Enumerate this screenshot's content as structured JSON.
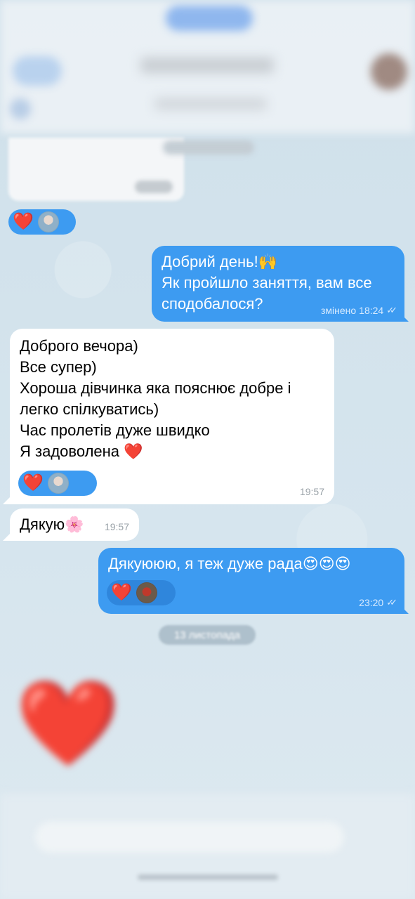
{
  "chat": {
    "messages": [
      {
        "id": "m1",
        "direction": "outgoing",
        "lines": [
          "Добрий день!🙌",
          "Як пройшло заняття, вам все",
          "сподобалося?"
        ],
        "edited_label": "змінено",
        "time": "18:24",
        "read": true
      },
      {
        "id": "m2",
        "direction": "incoming",
        "lines": [
          "Доброго вечора)",
          "Все супер)",
          "Хороша дівчинка яка пояснює добре і",
          "легко спілкуватись)",
          "Час пролетів дуже швидко",
          "Я задоволена ❤️"
        ],
        "reaction": "❤️",
        "time": "19:57"
      },
      {
        "id": "m3",
        "direction": "incoming",
        "lines": [
          "Дякую🌸"
        ],
        "time": "19:57"
      },
      {
        "id": "m4",
        "direction": "outgoing",
        "lines": [
          "Дякуююю, я теж дуже рада😍😍😍"
        ],
        "reaction": "❤️",
        "time": "23:20",
        "read": true
      }
    ],
    "earlier_reaction": "❤️",
    "date_separator": "13 листопада",
    "sticker": "❤️",
    "read_ticks": "✓✓"
  },
  "colors": {
    "outgoing_bubble": "#3d9bf1",
    "incoming_bubble": "#ffffff",
    "heart": "#e0142b"
  }
}
